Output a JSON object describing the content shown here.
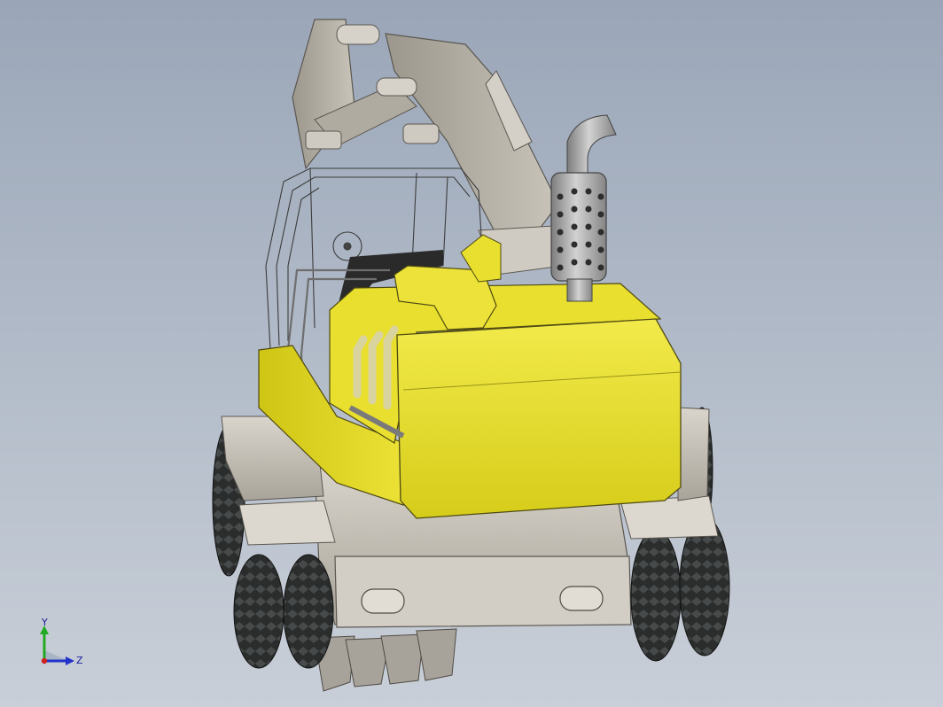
{
  "viewport": {
    "background_top": "#9aa6b8",
    "background_bottom": "#c9cfd8"
  },
  "model": {
    "body_color": "#e6dc2a",
    "steel_color": "#c7c2b8",
    "tire_color": "#2b2d2d"
  },
  "triad": {
    "y_label": "Y",
    "z_label": "Z",
    "y_color": "#22aa22",
    "z_color": "#2233cc",
    "x_color": "#cc2222"
  }
}
